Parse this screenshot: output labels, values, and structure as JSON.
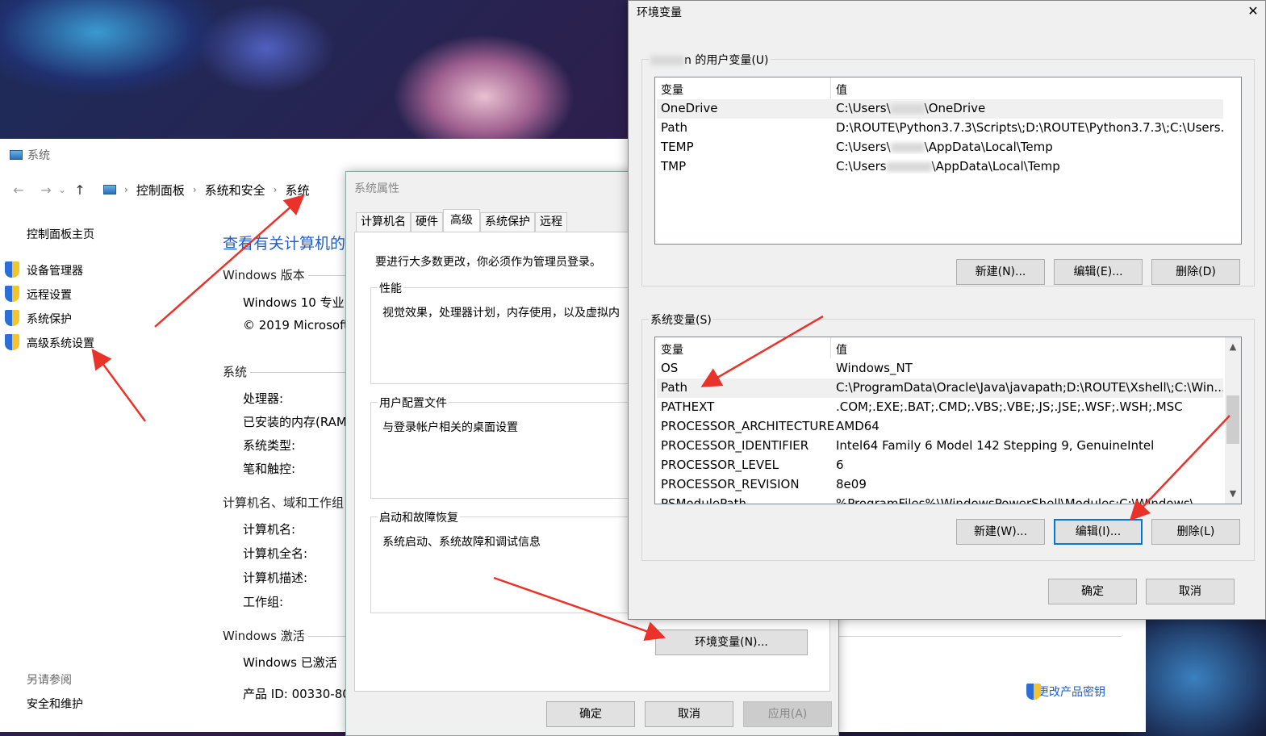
{
  "system_window": {
    "title": "系统",
    "nav": {
      "back": "←",
      "forward": "→",
      "dropdown": "⌄",
      "up": "↑"
    },
    "breadcrumb": [
      "控制面板",
      "系统和安全",
      "系统"
    ],
    "sidebar": {
      "home": "控制面板主页",
      "links": [
        "设备管理器",
        "远程设置",
        "系统保护",
        "高级系统设置"
      ],
      "see_also": "另请参阅",
      "security": "安全和维护"
    },
    "heading": "查看有关计算机的",
    "windows_edition_title": "Windows 版本",
    "windows_edition": "Windows 10 专业",
    "copyright": "© 2019 Microsoft",
    "system_title": "系统",
    "processor": "处理器:",
    "ram": "已安装的内存(RAM",
    "system_type": "系统类型:",
    "pen_touch": "笔和触控:",
    "computer_name_title": "计算机名、域和工作组",
    "computer_name": "计算机名:",
    "full_name": "计算机全名:",
    "description": "计算机描述:",
    "workgroup": "工作组:",
    "activation_title": "Windows 激活",
    "activation_status": "Windows 已激活",
    "product_id": "产品 ID: 00330-80",
    "change_key": "更改产品密钥"
  },
  "system_properties": {
    "title": "系统属性",
    "tabs": [
      "计算机名",
      "硬件",
      "高级",
      "系统保护",
      "远程"
    ],
    "admin_note": "要进行大多数更改，你必须作为管理员登录。",
    "performance": {
      "title": "性能",
      "desc": "视觉效果，处理器计划，内存使用，以及虚拟内"
    },
    "profiles": {
      "title": "用户配置文件",
      "desc": "与登录帐户相关的桌面设置"
    },
    "startup": {
      "title": "启动和故障恢复",
      "desc": "系统启动、系统故障和调试信息"
    },
    "env_button": "环境变量(N)...",
    "ok": "确定",
    "cancel": "取消",
    "apply": "应用(A)"
  },
  "env_vars": {
    "title": "环境变量",
    "close": "✕",
    "user_title_prefix": "n",
    "user_title": " 的用户变量(U)",
    "col_var": "变量",
    "col_val": "值",
    "user_rows": [
      {
        "name": "OneDrive",
        "value_a": "C:\\Users\\",
        "value_b": "\\OneDrive"
      },
      {
        "name": "Path",
        "value_a": "D:\\ROUTE\\Python3.7.3\\Scripts\\;D:\\ROUTE\\Python3.7.3\\;C:\\Users...",
        "value_b": ""
      },
      {
        "name": "TEMP",
        "value_a": "C:\\Users\\",
        "value_b": "\\AppData\\Local\\Temp"
      },
      {
        "name": "TMP",
        "value_a": "C:\\Users",
        "value_b": "\\AppData\\Local\\Temp"
      }
    ],
    "user_new": "新建(N)...",
    "user_edit": "编辑(E)...",
    "user_delete": "删除(D)",
    "system_title": "系统变量(S)",
    "system_rows": [
      {
        "name": "OS",
        "value": "Windows_NT"
      },
      {
        "name": "Path",
        "value": "C:\\ProgramData\\Oracle\\Java\\javapath;D:\\ROUTE\\Xshell\\;C:\\Win..."
      },
      {
        "name": "PATHEXT",
        "value": ".COM;.EXE;.BAT;.CMD;.VBS;.VBE;.JS;.JSE;.WSF;.WSH;.MSC"
      },
      {
        "name": "PROCESSOR_ARCHITECTURE",
        "value": "AMD64"
      },
      {
        "name": "PROCESSOR_IDENTIFIER",
        "value": "Intel64 Family 6 Model 142 Stepping 9, GenuineIntel"
      },
      {
        "name": "PROCESSOR_LEVEL",
        "value": "6"
      },
      {
        "name": "PROCESSOR_REVISION",
        "value": "8e09"
      },
      {
        "name": "PSModulePath",
        "value": "%ProgramFiles%\\WindowsPowerShell\\Modules;C:\\Windows\\..."
      }
    ],
    "sys_new": "新建(W)...",
    "sys_edit": "编辑(I)...",
    "sys_delete": "删除(L)",
    "ok": "确定",
    "cancel": "取消"
  },
  "colors": {
    "link": "#1e5ec8",
    "arrow": "#e8322a",
    "focus": "#0078d7"
  }
}
